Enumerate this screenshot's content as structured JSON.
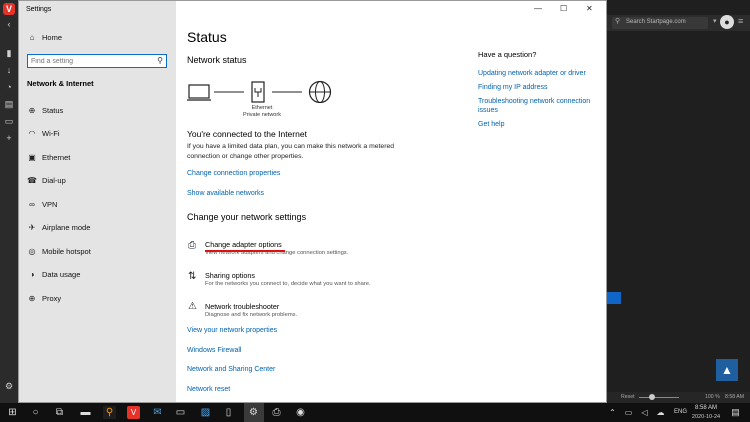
{
  "window": {
    "title": "Settings"
  },
  "nav": {
    "home": "Home",
    "search_placeholder": "Find a setting",
    "section": "Network & Internet",
    "items": [
      {
        "label": "Status",
        "icon": "home-globe-icon"
      },
      {
        "label": "Wi-Fi",
        "icon": "wifi-icon"
      },
      {
        "label": "Ethernet",
        "icon": "ethernet-icon"
      },
      {
        "label": "Dial-up",
        "icon": "phone-icon"
      },
      {
        "label": "VPN",
        "icon": "vpn-icon"
      },
      {
        "label": "Airplane mode",
        "icon": "airplane-icon"
      },
      {
        "label": "Mobile hotspot",
        "icon": "hotspot-icon"
      },
      {
        "label": "Data usage",
        "icon": "data-usage-icon"
      },
      {
        "label": "Proxy",
        "icon": "globe-icon"
      }
    ]
  },
  "main": {
    "title": "Status",
    "network_status": "Network status",
    "diagram": {
      "adapter": "Ethernet",
      "network": "Private network"
    },
    "connected": "You're connected to the Internet",
    "description": "If you have a limited data plan, you can make this network a metered connection or change other properties.",
    "links_top": [
      "Change connection properties",
      "Show available networks"
    ],
    "change_heading": "Change your network settings",
    "options": [
      {
        "title": "Change adapter options",
        "desc": "View network adapters and change connection settings."
      },
      {
        "title": "Sharing options",
        "desc": "For the networks you connect to, decide what you want to share."
      },
      {
        "title": "Network troubleshooter",
        "desc": "Diagnose and fix network problems."
      }
    ],
    "links_bottom": [
      "View your network properties",
      "Windows Firewall",
      "Network and Sharing Center",
      "Network reset"
    ]
  },
  "help": {
    "title": "Have a question?",
    "links": [
      "Updating network adapter or driver",
      "Finding my IP address",
      "Troubleshooting network connection issues",
      "Get help"
    ]
  },
  "browser": {
    "search_placeholder": "Search Startpage.com",
    "status_reset": "Reset",
    "zoom": "100 %",
    "clock": "8:58 AM"
  },
  "taskbar": {
    "lang": "ENG",
    "time": "8:58 AM",
    "date": "2020-10-24"
  },
  "colors": {
    "link": "#0063b1",
    "nav_bg": "#e4e4e4",
    "accent": "#0a6fc4",
    "underline": "#e01010"
  }
}
